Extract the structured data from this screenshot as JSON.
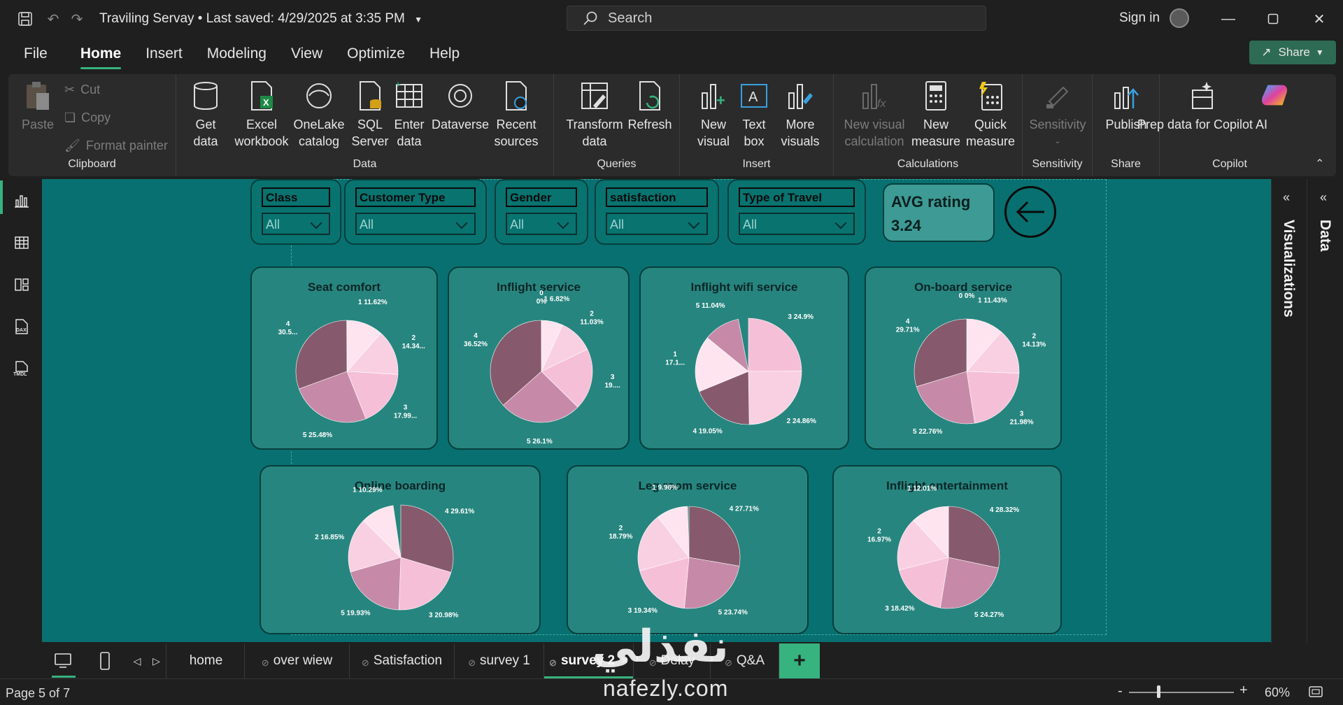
{
  "titlebar": {
    "file_title": "Traviling Servay",
    "saved_status": "Last saved: 4/29/2025 at 3:35 PM",
    "search_placeholder": "Search",
    "signin": "Sign in"
  },
  "menu": [
    "File",
    "Home",
    "Insert",
    "Modeling",
    "View",
    "Optimize",
    "Help"
  ],
  "share_label": "Share",
  "ribbon": {
    "clipboard": {
      "paste": "Paste",
      "cut": "Cut",
      "copy": "Copy",
      "format_painter": "Format painter",
      "group": "Clipboard"
    },
    "data": {
      "get_data": "Get data",
      "excel": "Excel workbook",
      "onelake": "OneLake catalog",
      "sql": "SQL Server",
      "enter": "Enter data",
      "dataverse": "Dataverse",
      "recent": "Recent sources",
      "group": "Data"
    },
    "queries": {
      "transform": "Transform data",
      "refresh": "Refresh",
      "group": "Queries"
    },
    "insert": {
      "new_visual": "New visual",
      "text_box": "Text box",
      "more_visuals": "More visuals",
      "group": "Insert"
    },
    "calculations": {
      "new_visual_calc": "New visual calculation",
      "new_measure": "New measure",
      "quick_measure": "Quick measure",
      "group": "Calculations"
    },
    "sensitivity": {
      "label": "Sensitivity",
      "group": "Sensitivity"
    },
    "share": {
      "publish": "Publish",
      "group": "Share"
    },
    "copilot": {
      "prep": "Prep data for Copilot AI",
      "group": "Copilot"
    }
  },
  "slicers": [
    {
      "label": "Class",
      "value": "All"
    },
    {
      "label": "Customer Type",
      "value": "All"
    },
    {
      "label": "Gender",
      "value": "All"
    },
    {
      "label": "satisfaction",
      "value": "All"
    },
    {
      "label": "Type of Travel",
      "value": "All"
    }
  ],
  "avg_card": {
    "title": "AVG rating",
    "value": "3.24"
  },
  "colors": {
    "canvas": "#087070",
    "card": "#27857f",
    "accent": "#36b37e",
    "slice_5": "#c68aa8",
    "slice_4": "#865a6c",
    "slice_3": "#f6bfd8",
    "slice_2": "#f9d0e2",
    "slice_1": "#fde4ef",
    "slice_0": "#ffffff"
  },
  "pies": [
    {
      "title": "Seat comfort",
      "slices": [
        {
          "name": "1",
          "pct": 11.62,
          "label": "1 11.62%"
        },
        {
          "name": "2",
          "pct": 14.34,
          "label": "2\n14.34..."
        },
        {
          "name": "3",
          "pct": 17.99,
          "label": "3\n17.99..."
        },
        {
          "name": "5",
          "pct": 25.48,
          "label": "5 25.48%"
        },
        {
          "name": "4",
          "pct": 30.5,
          "label": "4\n30.5..."
        }
      ]
    },
    {
      "title": "Inflight service",
      "slices": [
        {
          "name": "0",
          "pct": 0.0,
          "label": "0\n0%"
        },
        {
          "name": "1",
          "pct": 6.82,
          "label": "1 6.82%"
        },
        {
          "name": "2",
          "pct": 11.03,
          "label": "2\n11.03%"
        },
        {
          "name": "3",
          "pct": 19.5,
          "label": "3\n19...."
        },
        {
          "name": "5",
          "pct": 26.1,
          "label": "5 26.1%"
        },
        {
          "name": "4",
          "pct": 36.52,
          "label": "4\n36.52%"
        }
      ]
    },
    {
      "title": "Inflight wifi service",
      "slices": [
        {
          "name": "3",
          "pct": 24.9,
          "label": "3 24.9%"
        },
        {
          "name": "2",
          "pct": 24.86,
          "label": "2 24.86%"
        },
        {
          "name": "4",
          "pct": 19.05,
          "label": "4 19.05%"
        },
        {
          "name": "1",
          "pct": 17.1,
          "label": "1\n17.1..."
        },
        {
          "name": "5",
          "pct": 11.04,
          "label": "5 11.04%"
        }
      ]
    },
    {
      "title": "On-board service",
      "slices": [
        {
          "name": "0",
          "pct": 0.0,
          "label": "0 0%"
        },
        {
          "name": "1",
          "pct": 11.43,
          "label": "1 11.43%"
        },
        {
          "name": "2",
          "pct": 14.13,
          "label": "2\n14.13%"
        },
        {
          "name": "3",
          "pct": 21.98,
          "label": "3\n21.98%"
        },
        {
          "name": "5",
          "pct": 22.76,
          "label": "5 22.76%"
        },
        {
          "name": "4",
          "pct": 29.71,
          "label": "4\n29.71%"
        }
      ]
    },
    {
      "title": "Online boarding",
      "slices": [
        {
          "name": "4",
          "pct": 29.61,
          "label": "4 29.61%"
        },
        {
          "name": "3",
          "pct": 20.98,
          "label": "3 20.98%"
        },
        {
          "name": "5",
          "pct": 19.93,
          "label": "5 19.93%"
        },
        {
          "name": "2",
          "pct": 16.85,
          "label": "2 16.85%"
        },
        {
          "name": "1",
          "pct": 10.29,
          "label": "1 10.29%"
        }
      ]
    },
    {
      "title": "Leg room service",
      "slices": [
        {
          "name": "4",
          "pct": 27.71,
          "label": "4 27.71%"
        },
        {
          "name": "5",
          "pct": 23.74,
          "label": "5 23.74%"
        },
        {
          "name": "3",
          "pct": 19.34,
          "label": "3 19.34%"
        },
        {
          "name": "2",
          "pct": 18.79,
          "label": "2\n18.79%"
        },
        {
          "name": "1",
          "pct": 9.96,
          "label": "1 9.96%"
        }
      ]
    },
    {
      "title": "Inflight entertainment",
      "slices": [
        {
          "name": "4",
          "pct": 28.32,
          "label": "4 28.32%"
        },
        {
          "name": "5",
          "pct": 24.27,
          "label": "5 24.27%"
        },
        {
          "name": "3",
          "pct": 18.42,
          "label": "3 18.42%"
        },
        {
          "name": "2",
          "pct": 16.97,
          "label": "2\n16.97%"
        },
        {
          "name": "1",
          "pct": 12.01,
          "label": "1 12.01%"
        }
      ]
    }
  ],
  "panes": {
    "visualizations": "Visualizations",
    "data": "Data"
  },
  "tabs": [
    "home",
    "over wiew",
    "Satisfaction",
    "survey 1",
    "survey 2",
    "Delay",
    "Q&A"
  ],
  "status": {
    "page": "Page 5 of 7",
    "zoom": "60%"
  },
  "watermark": {
    "arabic": "نفذلي",
    "latin": "nafezly.com"
  }
}
